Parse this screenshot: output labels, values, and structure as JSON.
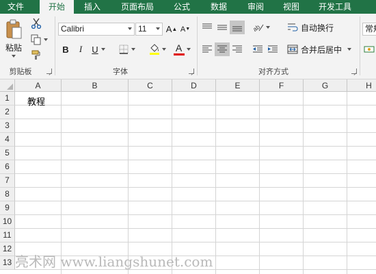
{
  "menu": {
    "tabs": [
      "文件",
      "开始",
      "插入",
      "页面布局",
      "公式",
      "数据",
      "审阅",
      "视图",
      "开发工具"
    ],
    "active_tab": "开始"
  },
  "ribbon": {
    "clipboard": {
      "paste_label": "粘贴",
      "group_label": "剪贴板"
    },
    "font": {
      "font_name": "Calibri",
      "font_size": "11",
      "bold": "B",
      "italic": "I",
      "underline": "U",
      "grow": "A",
      "shrink": "A",
      "font_color_letter": "A",
      "group_label": "字体",
      "fill_color": "#ffff00",
      "font_color": "#e00000"
    },
    "alignment": {
      "wrap_text": "自动换行",
      "merge_center": "合并后居中",
      "group_label": "对齐方式"
    },
    "number": {
      "format": "常规"
    }
  },
  "sheet": {
    "columns": [
      "A",
      "B",
      "C",
      "D",
      "E",
      "F",
      "G",
      "H"
    ],
    "rows": [
      "1",
      "2",
      "3",
      "4",
      "5",
      "6",
      "7",
      "8",
      "9",
      "10",
      "11",
      "12",
      "13"
    ],
    "cells": {
      "A1": "教程"
    }
  },
  "watermark": "亮术网 www.liangshunet.com"
}
